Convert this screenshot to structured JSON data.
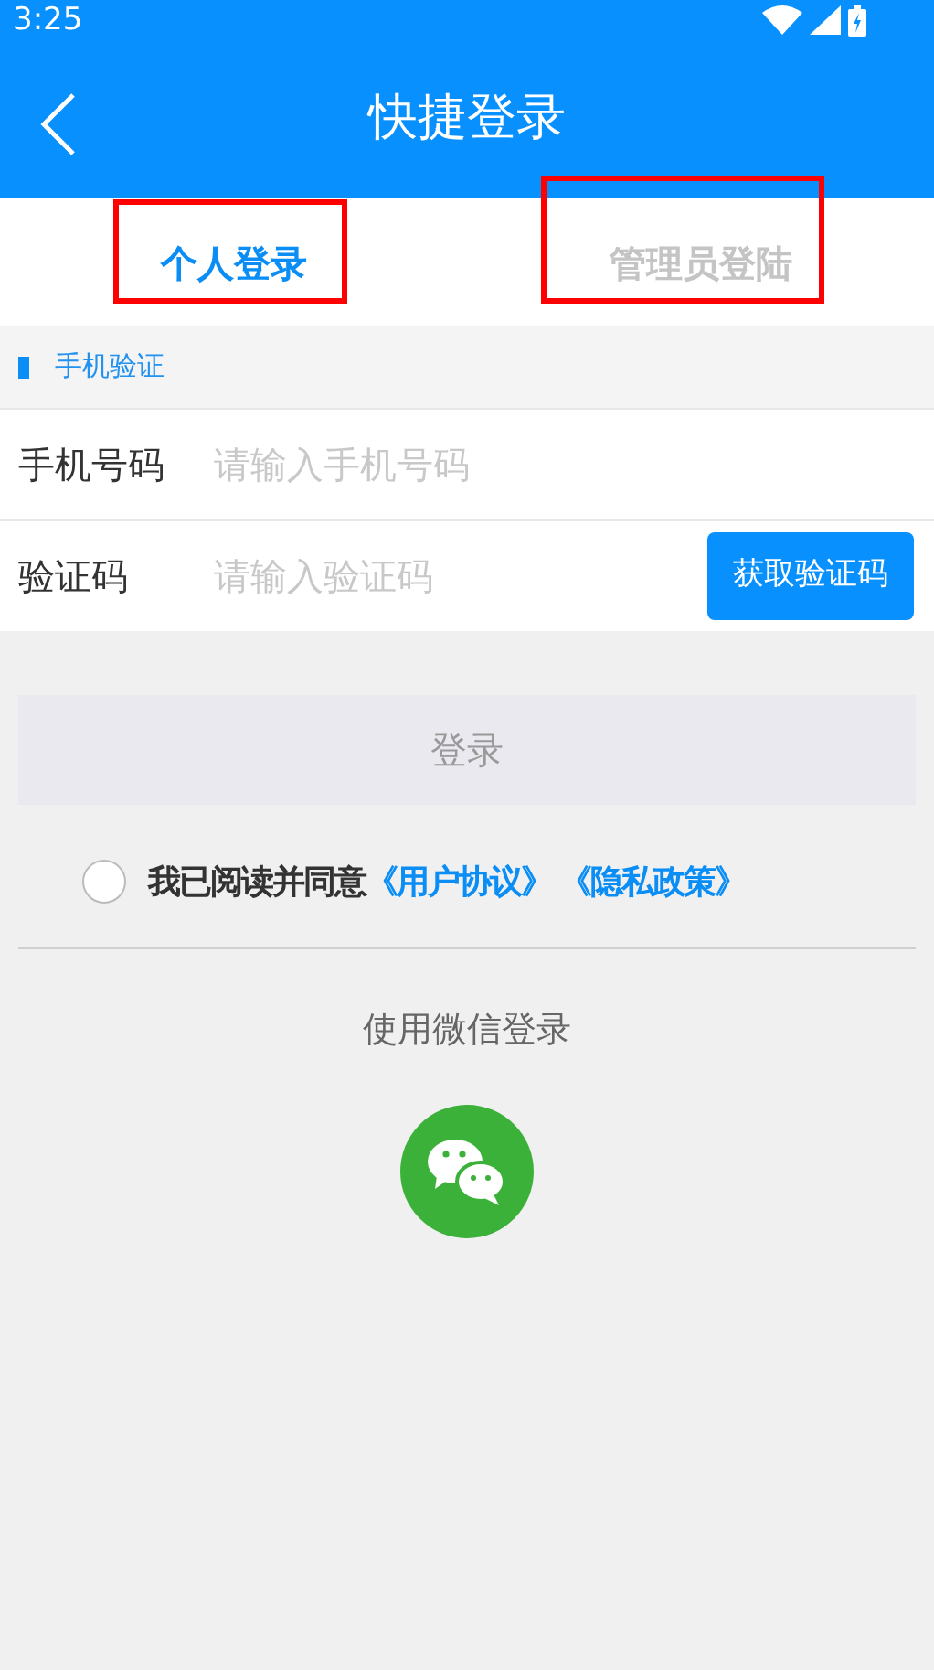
{
  "status_bar": {
    "time": "3:25"
  },
  "header": {
    "title": "快捷登录"
  },
  "tabs": [
    {
      "label": "个人登录",
      "selected": true,
      "highlighted": true
    },
    {
      "label": "管理员登陆",
      "selected": false,
      "highlighted": true
    }
  ],
  "section": {
    "title": "手机验证"
  },
  "fields": [
    {
      "label": "手机号码",
      "placeholder": "请输入手机号码"
    },
    {
      "label": "验证码",
      "placeholder": "请输入验证码",
      "button": "获取验证码"
    }
  ],
  "login_button": {
    "label": "登录",
    "disabled": true
  },
  "agreement": {
    "checked": false,
    "text": "我已阅读并同意",
    "links": [
      "《用户协议》",
      "《隐私政策》"
    ]
  },
  "wechat": {
    "label": "使用微信登录"
  }
}
